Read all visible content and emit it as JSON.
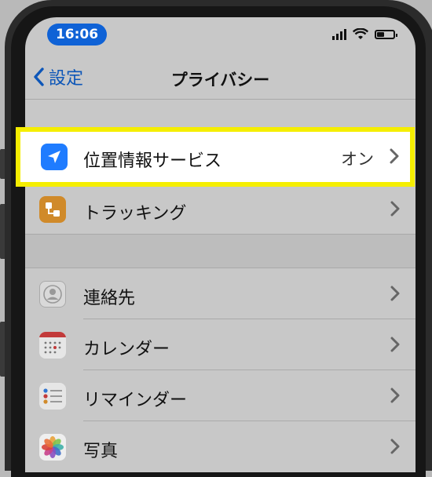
{
  "status": {
    "time": "16:06"
  },
  "nav": {
    "back_label": "設定",
    "title": "プライバシー"
  },
  "highlight_row": {
    "label": "位置情報サービス",
    "value": "オン",
    "icon": "location-arrow-icon"
  },
  "rows": [
    {
      "label": "トラッキング",
      "icon": "tracking-icon"
    },
    {
      "label": "連絡先",
      "icon": "contacts-icon"
    },
    {
      "label": "カレンダー",
      "icon": "calendar-icon"
    },
    {
      "label": "リマインダー",
      "icon": "reminders-icon"
    },
    {
      "label": "写真",
      "icon": "photos-icon"
    }
  ],
  "colors": {
    "accent": "#0d56b8",
    "highlight": "#f5ee00",
    "location_icon": "#1f7cff",
    "tracking_icon": "#d08a2a"
  }
}
